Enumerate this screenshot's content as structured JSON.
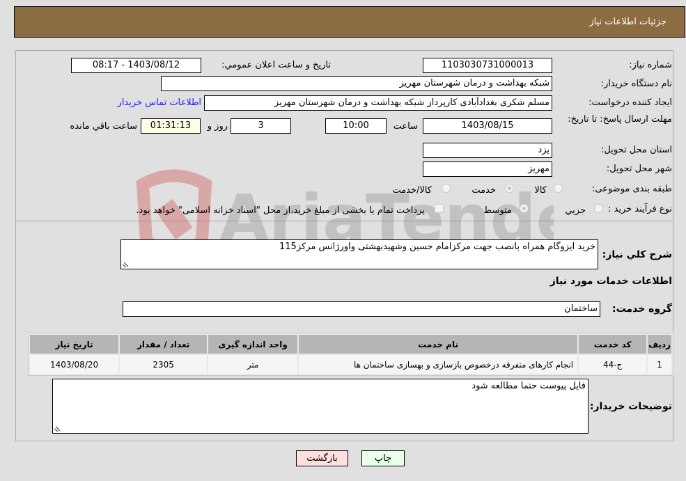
{
  "header": {
    "title": "جزئیات اطلاعات نیاز"
  },
  "fields": {
    "need_number": {
      "label": "شماره نیاز:",
      "value": "1103030731000013"
    },
    "announce_datetime": {
      "label": "تاریخ و ساعت اعلان عمومي:",
      "value": "1403/08/12 - 08:17"
    },
    "buyer_org": {
      "label": "نام دستگاه خریدار:",
      "value": "شبکه بهداشت و درمان شهرستان مهریز"
    },
    "requester": {
      "label": "ایجاد کننده درخواست:",
      "value": "مسلم شکری بغدادآبادی کارپرداز شبکه بهداشت و درمان شهرستان مهریز"
    },
    "buyer_contact_link": "اطلاعات تماس خریدار",
    "deadline": {
      "label": "مهلت ارسال پاسخ: تا تاریخ:",
      "date": "1403/08/15",
      "time_label": "ساعت",
      "time": "10:00",
      "days": "3",
      "days_label": "روز و",
      "remaining": "01:31:13",
      "remaining_label": "ساعت باقي مانده"
    },
    "province": {
      "label": "استان محل تحویل:",
      "value": "یزد"
    },
    "city": {
      "label": "شهر محل تحویل:",
      "value": "مهریز"
    },
    "category": {
      "label": "طبقه بندی موضوعی:",
      "options": [
        "کالا",
        "خدمت",
        "کالا/خدمت"
      ],
      "selected": "خدمت"
    },
    "purchase_type": {
      "label": "نوع فرآیند خرید :",
      "options": [
        "جزيي",
        "متوسط"
      ],
      "selected": "متوسط",
      "treasury_note": "پرداخت تمام یا بخشی از مبلغ خرید،از محل \"اسناد خزانه اسلامی\" خواهد بود."
    }
  },
  "description": {
    "label": "شرح كلي نياز:",
    "value": "خرید ایزوگام همراه بانصب جهت مرکزامام حسین وشهیدبهشتی واورژانس مرکز115"
  },
  "services_section": {
    "title": "اطلاعات خدمات مورد نیاز"
  },
  "service_group": {
    "label": "گروه خدمت:",
    "value": "ساختمان"
  },
  "table": {
    "headers": [
      "ردیف",
      "کد خدمت",
      "نام خدمت",
      "واحد اندازه گیری",
      "تعداد / مقدار",
      "تاریخ نیاز"
    ],
    "rows": [
      [
        "1",
        "ج-44",
        "انجام کارهای متفرقه درخصوص بازسازی و بهسازی ساختمان ها",
        "متر",
        "2305",
        "1403/08/20"
      ]
    ]
  },
  "buyer_notes": {
    "label": "توضیحات خریدار:",
    "value": "فایل پیوست حتما مطالعه شود"
  },
  "buttons": {
    "print": "چاپ",
    "back": "بازگشت"
  },
  "watermark": "AriaTender.neT",
  "colors": {
    "header_bg": "#8c6d42",
    "print_bg": "#eaffea",
    "back_bg": "#ffdede",
    "link": "#1a1aff"
  }
}
